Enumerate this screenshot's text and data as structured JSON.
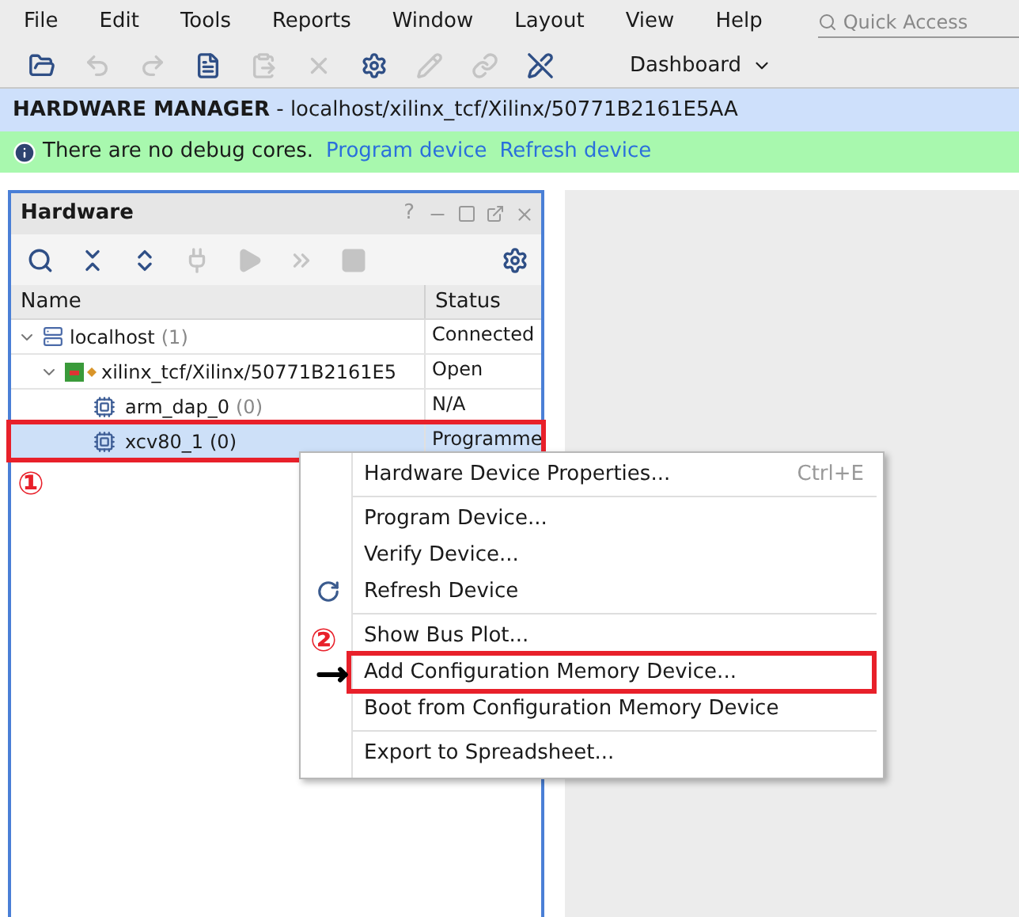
{
  "menu_bar": {
    "items": [
      "File",
      "Edit",
      "Tools",
      "Reports",
      "Window",
      "Layout",
      "View",
      "Help"
    ],
    "quick_access": {
      "placeholder": "Quick Access"
    }
  },
  "toolbar": {
    "tools": [
      {
        "kind": "open",
        "disabled": false
      },
      {
        "kind": "undo",
        "disabled": true
      },
      {
        "kind": "redo",
        "disabled": true
      },
      {
        "kind": "doc",
        "disabled": false
      },
      {
        "kind": "paste",
        "disabled": true
      },
      {
        "kind": "delete",
        "disabled": true
      },
      {
        "kind": "settings",
        "disabled": false
      },
      {
        "kind": "probe",
        "disabled": true
      },
      {
        "kind": "link",
        "disabled": true
      },
      {
        "kind": "pen",
        "disabled": false
      }
    ],
    "layout_menu": "Dashboard"
  },
  "title_bar": {
    "title": "HARDWARE MANAGER",
    "path": " - localhost/xilinx_tcf/Xilinx/50771B2161E5AA"
  },
  "info_bar": {
    "message": "There are no debug cores.",
    "links": [
      "Program device",
      "Refresh device"
    ]
  },
  "hardware_panel": {
    "title": "Hardware",
    "help": "?",
    "tools": [
      {
        "kind": "search",
        "disabled": false
      },
      {
        "kind": "collapse",
        "disabled": false
      },
      {
        "kind": "expand",
        "disabled": false
      },
      {
        "kind": "plug",
        "disabled": true
      },
      {
        "kind": "play",
        "disabled": true
      },
      {
        "kind": "forward",
        "disabled": true
      },
      {
        "kind": "stop",
        "disabled": true
      }
    ],
    "columns": [
      "Name",
      "Status"
    ],
    "tree": [
      {
        "kind": "host",
        "name": "localhost",
        "count": "(1)",
        "status": "Connected",
        "expanded": true,
        "selected": false,
        "marked": false,
        "children": [
          {
            "kind": "target",
            "name": "xilinx_tcf/Xilinx/50771B2161E5",
            "status": "Open",
            "expanded": true,
            "selected": false,
            "marked": false,
            "children": [
              {
                "kind": "chip",
                "name": "arm_dap_0",
                "count": "(0)",
                "status": "N/A",
                "selected": false,
                "marked": false
              },
              {
                "kind": "chip",
                "name": "xcv80_1",
                "count": "(0)",
                "status": "Programme",
                "selected": true,
                "marked": true
              }
            ]
          }
        ]
      }
    ]
  },
  "context_menu": {
    "groups": [
      [
        {
          "label": "Hardware Device Properties...",
          "shortcut": "Ctrl+E",
          "marked": false
        }
      ],
      [
        {
          "label": "Program Device...",
          "marked": false
        },
        {
          "label": "Verify Device...",
          "marked": false
        },
        {
          "label": "Refresh Device",
          "kind": "refresh",
          "marked": false
        }
      ],
      [
        {
          "label": "Show Bus Plot...",
          "marked": false
        },
        {
          "label": "Add Configuration Memory Device...",
          "marked": true
        },
        {
          "label": "Boot from Configuration Memory Device",
          "marked": false
        }
      ],
      [
        {
          "label": "Export to Spreadsheet...",
          "marked": false
        }
      ]
    ]
  },
  "annotations": [
    "①",
    "②"
  ]
}
